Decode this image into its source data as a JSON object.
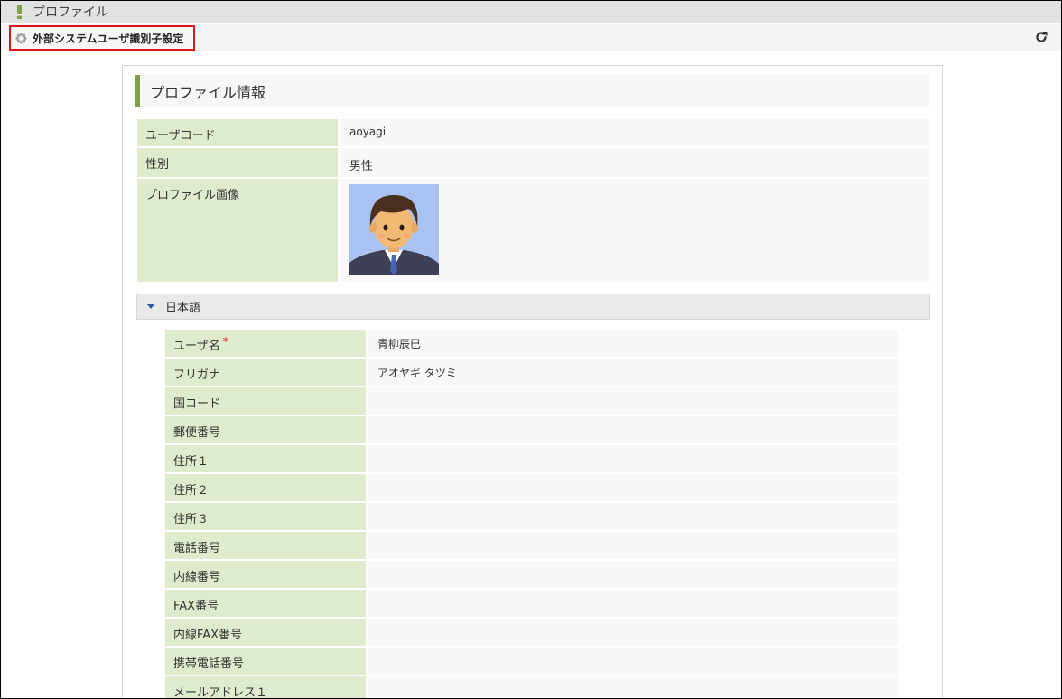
{
  "window": {
    "title": "プロファイル"
  },
  "toolbar": {
    "link_label": "外部システムユーザ識別子設定"
  },
  "profile": {
    "heading": "プロファイル情報",
    "rows": [
      {
        "label": "ユーザコード",
        "value": "aoyagi"
      },
      {
        "label": "性別",
        "value": "男性"
      },
      {
        "label": "プロファイル画像",
        "value": ""
      }
    ]
  },
  "language_section": {
    "label": "日本語",
    "rows": [
      {
        "label": "ユーザ名",
        "value": "青柳辰巳",
        "required_mark": "*"
      },
      {
        "label": "フリガナ",
        "value": "アオヤギ タツミ"
      },
      {
        "label": "国コード",
        "value": ""
      },
      {
        "label": "郵便番号",
        "value": ""
      },
      {
        "label": "住所１",
        "value": ""
      },
      {
        "label": "住所２",
        "value": ""
      },
      {
        "label": "住所３",
        "value": ""
      },
      {
        "label": "電話番号",
        "value": ""
      },
      {
        "label": "内線番号",
        "value": ""
      },
      {
        "label": "FAX番号",
        "value": ""
      },
      {
        "label": "内線FAX番号",
        "value": ""
      },
      {
        "label": "携帯電話番号",
        "value": ""
      },
      {
        "label": "メールアドレス１",
        "value": ""
      }
    ]
  },
  "colors": {
    "accent": "#7fa04a",
    "label_bg": "#deebcc",
    "highlight": "#d9141c"
  },
  "icons": {
    "toolbar": "gear-icon",
    "refresh": "refresh-icon",
    "collapse": "caret-down-icon"
  }
}
